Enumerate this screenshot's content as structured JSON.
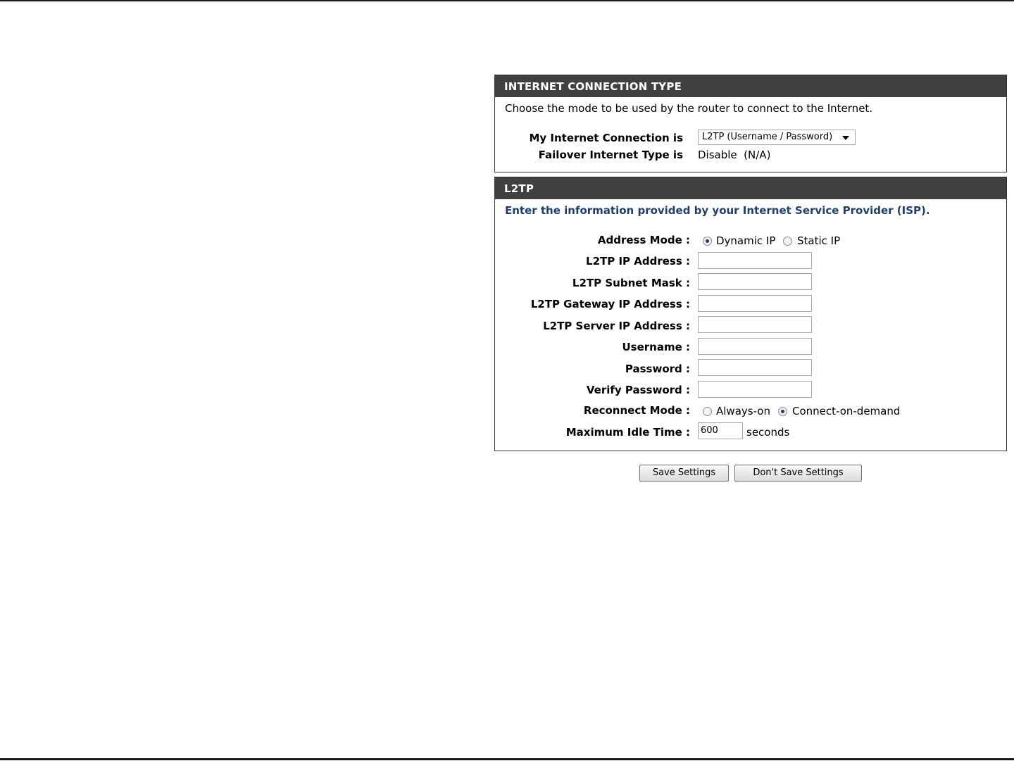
{
  "connection_type": {
    "header": "INTERNET CONNECTION TYPE",
    "intro": "Choose the mode to be used by the router to connect to the Internet.",
    "connection_label": "My Internet Connection is",
    "connection_value": "L2TP (Username / Password)",
    "failover_label": "Failover Internet Type is",
    "failover_value": "Disable  (N/A)"
  },
  "l2tp": {
    "header": "L2TP",
    "intro": "Enter the information provided by your Internet Service Provider (ISP).",
    "address_mode": {
      "label": "Address Mode :",
      "options": [
        "Dynamic IP",
        "Static IP"
      ],
      "selected": "Dynamic IP"
    },
    "fields": {
      "ip_address": {
        "label": "L2TP IP Address :",
        "value": ""
      },
      "subnet_mask": {
        "label": "L2TP Subnet Mask :",
        "value": ""
      },
      "gateway_ip": {
        "label": "L2TP Gateway IP Address :",
        "value": ""
      },
      "server_ip": {
        "label": "L2TP Server IP Address :",
        "value": ""
      },
      "username": {
        "label": "Username :",
        "value": ""
      },
      "password": {
        "label": "Password :",
        "value": ""
      },
      "verify_password": {
        "label": "Verify Password :",
        "value": ""
      }
    },
    "reconnect_mode": {
      "label": "Reconnect Mode :",
      "options": [
        "Always-on",
        "Connect-on-demand"
      ],
      "selected": "Connect-on-demand"
    },
    "idle_time": {
      "label": "Maximum Idle Time :",
      "value": "600",
      "unit": "seconds"
    }
  },
  "buttons": {
    "save": "Save Settings",
    "dont_save": "Don't Save Settings"
  },
  "colors": {
    "header_bg": "#404040",
    "header_text": "#ffffff",
    "intro_blue": "#1e3f74"
  }
}
